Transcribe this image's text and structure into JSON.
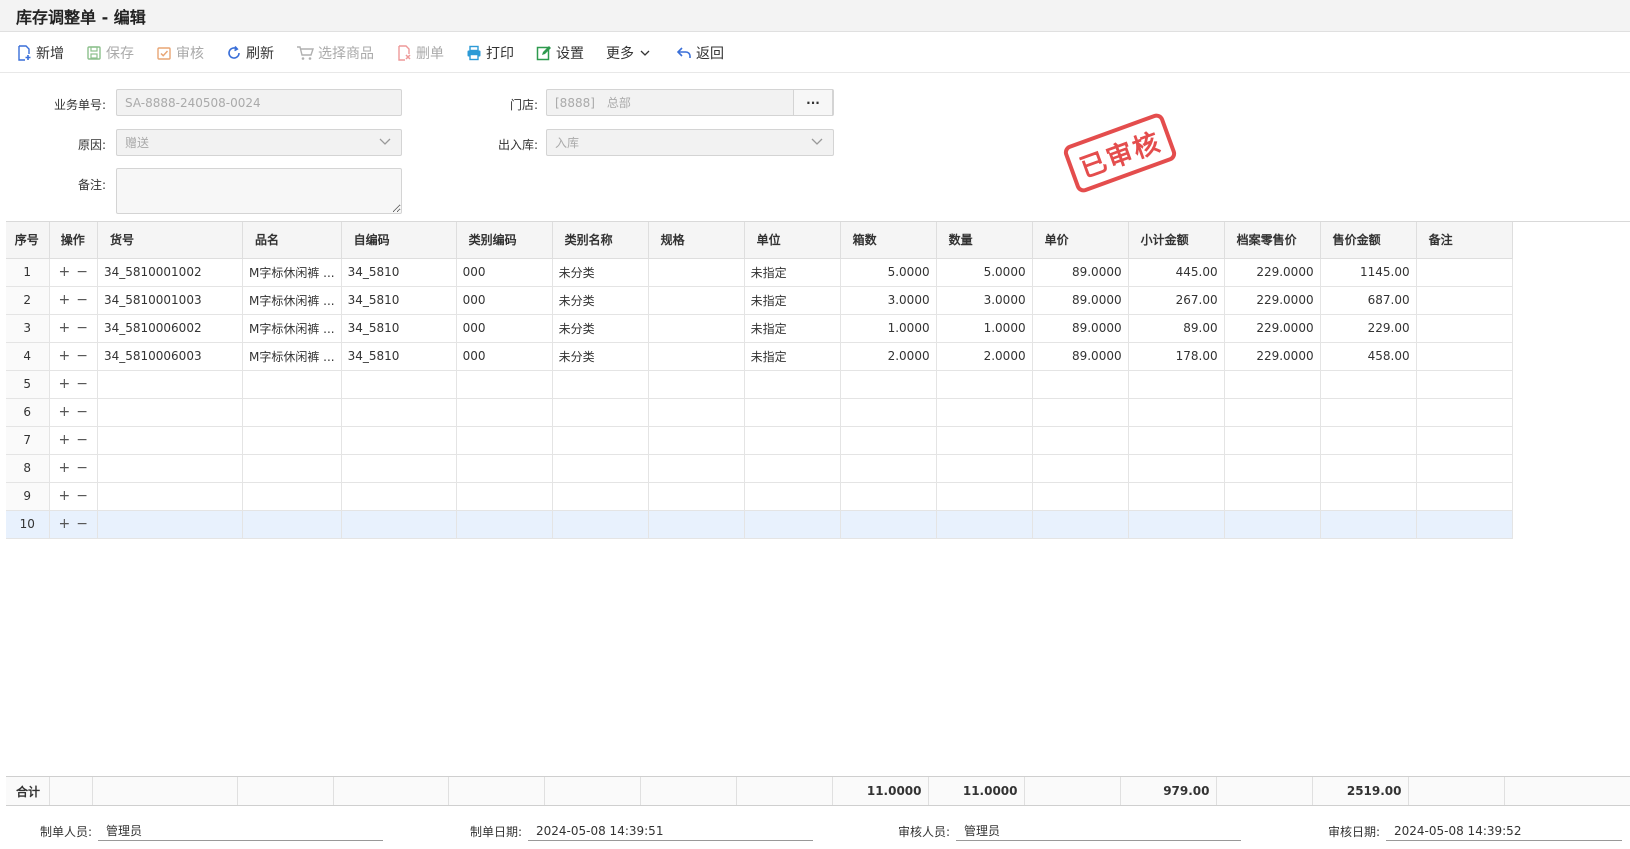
{
  "window": {
    "title": "库存调整单 - 编辑"
  },
  "toolbar": {
    "items": [
      {
        "label": "新增",
        "icon": "add-doc-icon",
        "enabled": true
      },
      {
        "label": "保存",
        "icon": "save-icon",
        "enabled": false
      },
      {
        "label": "审核",
        "icon": "audit-check-icon",
        "enabled": false
      },
      {
        "label": "刷新",
        "icon": "refresh-icon",
        "enabled": true
      },
      {
        "label": "选择商品",
        "icon": "cart-icon",
        "enabled": false
      },
      {
        "label": "删单",
        "icon": "delete-doc-icon",
        "enabled": false
      },
      {
        "label": "打印",
        "icon": "printer-icon",
        "enabled": true
      },
      {
        "label": "设置",
        "icon": "edit-settings-icon",
        "enabled": true
      },
      {
        "label": "更多",
        "icon": "chevron-down-icon",
        "enabled": true
      },
      {
        "label": "返回",
        "icon": "return-icon",
        "enabled": true
      }
    ],
    "colors": {
      "blue": "#3a6fd8",
      "disabled": "#aaaaaa"
    }
  },
  "form": {
    "doc_no_label": "业务单号:",
    "doc_no_value": "SA-8888-240508-0024",
    "reason_label": "原因:",
    "reason_value": "赠送",
    "remark_label": "备注:",
    "remark_value": "",
    "store_label": "门店:",
    "store_code": "[8888]",
    "store_name": "总部",
    "store_btn": "···",
    "inout_label": "出入库:",
    "inout_value": "入库"
  },
  "stamp": {
    "text": "已审核",
    "color": "#e23a3a"
  },
  "grid": {
    "columns": [
      "序号",
      "操作",
      "货号",
      "品名",
      "自编码",
      "类别编码",
      "类别名称",
      "规格",
      "单位",
      "箱数",
      "数量",
      "单价",
      "小计金额",
      "档案零售价",
      "售价金额",
      "备注"
    ],
    "rows": [
      {
        "idx": "1",
        "sku": "34_5810001002",
        "name": "M字标休闲裤 ...",
        "code": "34_5810",
        "cat_code": "000",
        "cat_name": "未分类",
        "spec": "",
        "unit": "未指定",
        "boxes": "5.0000",
        "qty": "5.0000",
        "price": "89.0000",
        "subtotal": "445.00",
        "retail": "229.0000",
        "sale_amt": "1145.00",
        "remark": ""
      },
      {
        "idx": "2",
        "sku": "34_5810001003",
        "name": "M字标休闲裤 ...",
        "code": "34_5810",
        "cat_code": "000",
        "cat_name": "未分类",
        "spec": "",
        "unit": "未指定",
        "boxes": "3.0000",
        "qty": "3.0000",
        "price": "89.0000",
        "subtotal": "267.00",
        "retail": "229.0000",
        "sale_amt": "687.00",
        "remark": ""
      },
      {
        "idx": "3",
        "sku": "34_5810006002",
        "name": "M字标休闲裤 ...",
        "code": "34_5810",
        "cat_code": "000",
        "cat_name": "未分类",
        "spec": "",
        "unit": "未指定",
        "boxes": "1.0000",
        "qty": "1.0000",
        "price": "89.0000",
        "subtotal": "89.00",
        "retail": "229.0000",
        "sale_amt": "229.00",
        "remark": ""
      },
      {
        "idx": "4",
        "sku": "34_5810006003",
        "name": "M字标休闲裤 ...",
        "code": "34_5810",
        "cat_code": "000",
        "cat_name": "未分类",
        "spec": "",
        "unit": "未指定",
        "boxes": "2.0000",
        "qty": "2.0000",
        "price": "89.0000",
        "subtotal": "178.00",
        "retail": "229.0000",
        "sale_amt": "458.00",
        "remark": ""
      },
      {
        "idx": "5"
      },
      {
        "idx": "6"
      },
      {
        "idx": "7"
      },
      {
        "idx": "8"
      },
      {
        "idx": "9"
      },
      {
        "idx": "10",
        "selected": true
      }
    ],
    "op_add": "+",
    "op_remove": "−"
  },
  "totals": {
    "label": "合计",
    "boxes": "11.0000",
    "qty": "11.0000",
    "subtotal": "979.00",
    "sale_amt": "2519.00"
  },
  "meta": {
    "creator_label": "制单人员:",
    "creator": "管理员",
    "created_label": "制单日期:",
    "created": "2024-05-08 14:39:51",
    "auditor_label": "审核人员:",
    "auditor": "管理员",
    "audited_label": "审核日期:",
    "audited": "2024-05-08 14:39:52"
  }
}
